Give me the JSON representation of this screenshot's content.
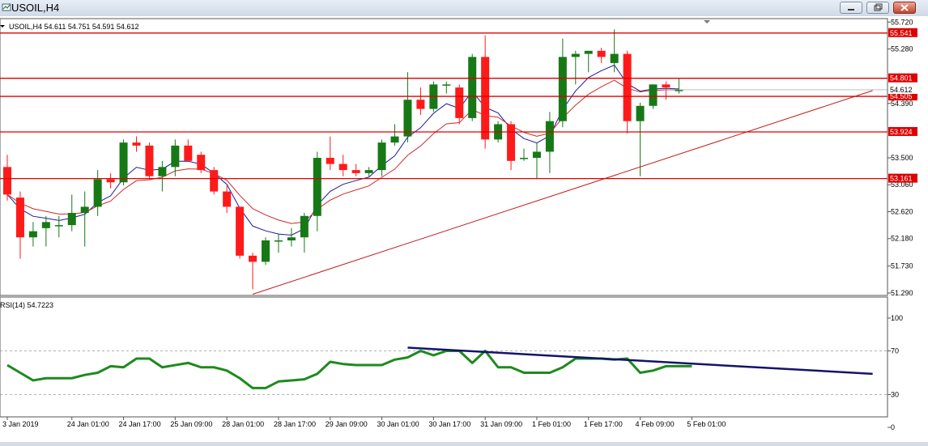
{
  "window": {
    "title": "USOIL,H4",
    "controls": [
      "minimize",
      "restore",
      "close"
    ]
  },
  "chart_data": [
    {
      "type": "candlestick",
      "symbol_header": "USOIL,H4  54.611 54.751 54.591 54.612",
      "ylim": [
        51.25,
        55.75
      ],
      "y_ticks": [
        "55.720",
        "55.280",
        "54.390",
        "53.500",
        "53.060",
        "52.620",
        "52.180",
        "51.730",
        "51.290"
      ],
      "y_tick_values": [
        55.72,
        55.28,
        54.39,
        53.5,
        53.06,
        52.62,
        52.18,
        51.73,
        51.29
      ],
      "current_price_label": "54.612",
      "current_price": 54.612,
      "x_labels": [
        "3 Jan 2019",
        "24 Jan 01:00",
        "24 Jan 17:00",
        "25 Jan 09:00",
        "28 Jan 01:00",
        "28 Jan 17:00",
        "29 Jan 09:00",
        "30 Jan 01:00",
        "30 Jan 17:00",
        "31 Jan 09:00",
        "1 Feb 01:00",
        "1 Feb 17:00",
        "4 Feb 09:00",
        "5 Feb 01:00"
      ],
      "x_label_bar_index": [
        0,
        5,
        9,
        13,
        17,
        21,
        25,
        29,
        33,
        37,
        41,
        45,
        49,
        53
      ],
      "candles": [
        {
          "o": 53.35,
          "h": 53.55,
          "l": 52.8,
          "c": 52.9
        },
        {
          "o": 52.85,
          "h": 52.95,
          "l": 51.85,
          "c": 52.2
        },
        {
          "o": 52.2,
          "h": 52.45,
          "l": 52.05,
          "c": 52.3
        },
        {
          "o": 52.35,
          "h": 52.55,
          "l": 52.05,
          "c": 52.45
        },
        {
          "o": 52.4,
          "h": 52.55,
          "l": 52.2,
          "c": 52.4
        },
        {
          "o": 52.4,
          "h": 52.9,
          "l": 52.3,
          "c": 52.6
        },
        {
          "o": 52.6,
          "h": 52.95,
          "l": 52.05,
          "c": 52.7
        },
        {
          "o": 52.7,
          "h": 53.3,
          "l": 52.55,
          "c": 53.15
        },
        {
          "o": 53.15,
          "h": 53.25,
          "l": 53.0,
          "c": 53.1
        },
        {
          "o": 53.1,
          "h": 53.8,
          "l": 53.05,
          "c": 53.75
        },
        {
          "o": 53.75,
          "h": 53.85,
          "l": 53.6,
          "c": 53.7
        },
        {
          "o": 53.7,
          "h": 53.75,
          "l": 53.15,
          "c": 53.2
        },
        {
          "o": 53.2,
          "h": 53.45,
          "l": 52.95,
          "c": 53.35
        },
        {
          "o": 53.35,
          "h": 53.8,
          "l": 53.2,
          "c": 53.7
        },
        {
          "o": 53.7,
          "h": 53.8,
          "l": 53.45,
          "c": 53.45
        },
        {
          "o": 53.55,
          "h": 53.6,
          "l": 53.25,
          "c": 53.3
        },
        {
          "o": 53.3,
          "h": 53.35,
          "l": 52.9,
          "c": 52.95
        },
        {
          "o": 52.95,
          "h": 53.05,
          "l": 52.6,
          "c": 52.7
        },
        {
          "o": 52.7,
          "h": 52.7,
          "l": 51.85,
          "c": 51.9
        },
        {
          "o": 51.9,
          "h": 51.95,
          "l": 51.35,
          "c": 51.8
        },
        {
          "o": 51.8,
          "h": 52.2,
          "l": 51.75,
          "c": 52.15
        },
        {
          "o": 52.15,
          "h": 52.25,
          "l": 51.95,
          "c": 52.15
        },
        {
          "o": 52.15,
          "h": 52.35,
          "l": 52.05,
          "c": 52.2
        },
        {
          "o": 52.2,
          "h": 52.6,
          "l": 51.95,
          "c": 52.55
        },
        {
          "o": 52.55,
          "h": 53.6,
          "l": 52.3,
          "c": 53.5
        },
        {
          "o": 53.5,
          "h": 53.85,
          "l": 53.3,
          "c": 53.4
        },
        {
          "o": 53.4,
          "h": 53.55,
          "l": 53.2,
          "c": 53.3
        },
        {
          "o": 53.3,
          "h": 53.4,
          "l": 53.2,
          "c": 53.25
        },
        {
          "o": 53.25,
          "h": 53.35,
          "l": 53.2,
          "c": 53.3
        },
        {
          "o": 53.3,
          "h": 53.8,
          "l": 53.2,
          "c": 53.75
        },
        {
          "o": 53.75,
          "h": 54.05,
          "l": 53.7,
          "c": 53.85
        },
        {
          "o": 53.85,
          "h": 54.9,
          "l": 53.75,
          "c": 54.45
        },
        {
          "o": 54.45,
          "h": 54.65,
          "l": 54.2,
          "c": 54.3
        },
        {
          "o": 54.3,
          "h": 54.75,
          "l": 54.25,
          "c": 54.7
        },
        {
          "o": 54.7,
          "h": 54.75,
          "l": 54.55,
          "c": 54.7
        },
        {
          "o": 54.65,
          "h": 54.7,
          "l": 54.05,
          "c": 54.15
        },
        {
          "o": 54.15,
          "h": 55.2,
          "l": 54.1,
          "c": 55.15
        },
        {
          "o": 55.15,
          "h": 55.5,
          "l": 53.65,
          "c": 53.8
        },
        {
          "o": 53.8,
          "h": 54.1,
          "l": 53.75,
          "c": 54.05
        },
        {
          "o": 54.05,
          "h": 54.1,
          "l": 53.3,
          "c": 53.45
        },
        {
          "o": 53.5,
          "h": 53.65,
          "l": 53.45,
          "c": 53.5
        },
        {
          "o": 53.5,
          "h": 53.75,
          "l": 53.15,
          "c": 53.6
        },
        {
          "o": 53.6,
          "h": 54.25,
          "l": 53.25,
          "c": 54.1
        },
        {
          "o": 54.1,
          "h": 55.45,
          "l": 54.0,
          "c": 55.15
        },
        {
          "o": 55.15,
          "h": 55.25,
          "l": 54.7,
          "c": 55.2
        },
        {
          "o": 55.2,
          "h": 55.25,
          "l": 54.9,
          "c": 55.25
        },
        {
          "o": 55.25,
          "h": 55.3,
          "l": 55.05,
          "c": 55.15
        },
        {
          "o": 55.05,
          "h": 55.6,
          "l": 54.9,
          "c": 55.2
        },
        {
          "o": 55.2,
          "h": 55.25,
          "l": 53.9,
          "c": 54.1
        },
        {
          "o": 54.1,
          "h": 54.4,
          "l": 53.2,
          "c": 54.35
        },
        {
          "o": 54.35,
          "h": 54.7,
          "l": 54.3,
          "c": 54.7
        },
        {
          "o": 54.7,
          "h": 54.75,
          "l": 54.45,
          "c": 54.65
        },
        {
          "o": 54.6,
          "h": 54.8,
          "l": 54.55,
          "c": 54.61
        }
      ],
      "horizontal_levels": [
        {
          "label": "55.541",
          "value": 55.541
        },
        {
          "label": "54.801",
          "value": 54.801
        },
        {
          "label": "54.505",
          "value": 54.505
        },
        {
          "label": "53.924",
          "value": 53.924
        },
        {
          "label": "53.161",
          "value": 53.161
        }
      ],
      "trendline": [
        {
          "bar": 19,
          "price": 51.27
        },
        {
          "bar": 67,
          "price": 54.6
        }
      ],
      "ma_fast_color": "#1a1a9e",
      "ma_slow_color": "#cc2a2a",
      "bull_color": "#167916",
      "bear_color": "#ff1a1a",
      "level_color": "#dd0000"
    },
    {
      "type": "line",
      "indicator_label": "RSI(14) 54.7223",
      "ylim": [
        0,
        100
      ],
      "y_ticks": [
        "100",
        "70",
        "30",
        "0"
      ],
      "y_tick_values": [
        100,
        70,
        30,
        0
      ],
      "levels": [
        70,
        30
      ],
      "rsi_values": [
        57,
        50,
        43,
        45,
        45,
        45,
        48,
        50,
        56,
        55,
        63,
        63,
        55,
        57,
        59,
        55,
        55,
        52,
        45,
        36,
        36,
        42,
        43,
        44,
        49,
        60,
        58,
        57,
        57,
        57,
        62,
        64,
        70,
        66,
        70,
        70,
        59,
        70,
        55,
        55,
        50,
        50,
        50,
        55,
        63,
        63,
        63,
        62,
        63,
        50,
        52,
        56,
        56,
        56
      ],
      "trendline": [
        {
          "bar": 31,
          "value": 73
        },
        {
          "bar": 67,
          "value": 49
        }
      ],
      "rsi_color": "#1e8a1e",
      "trendline_color": "#13136b"
    }
  ]
}
